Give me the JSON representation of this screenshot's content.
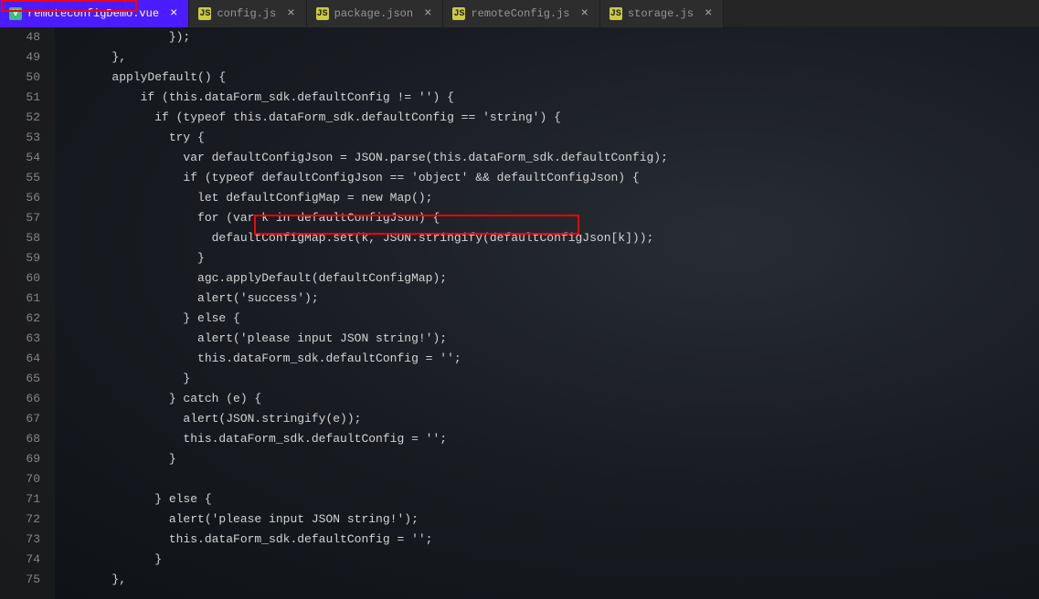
{
  "tabs": [
    {
      "icon": "V",
      "label": "remoteconfigDemo.vue",
      "active": true
    },
    {
      "icon": "JS",
      "label": "config.js",
      "active": false
    },
    {
      "icon": "JS",
      "label": "package.json",
      "active": false
    },
    {
      "icon": "JS",
      "label": "remoteConfig.js",
      "active": false
    },
    {
      "icon": "JS",
      "label": "storage.js",
      "active": false
    }
  ],
  "tab_close": "×",
  "line_numbers": [
    "48",
    "49",
    "50",
    "51",
    "52",
    "53",
    "54",
    "55",
    "56",
    "57",
    "58",
    "59",
    "60",
    "61",
    "62",
    "63",
    "64",
    "65",
    "66",
    "67",
    "68",
    "69",
    "70",
    "71",
    "72",
    "73",
    "74",
    "75"
  ],
  "code": {
    "l48": "                });",
    "l49": "        },",
    "l50": "        applyDefault() {",
    "l51": "            if (this.dataForm_sdk.defaultConfig != '') {",
    "l52": "              if (typeof this.dataForm_sdk.defaultConfig == 'string') {",
    "l53": "                try {",
    "l54": "                  var defaultConfigJson = JSON.parse(this.dataForm_sdk.defaultConfig);",
    "l55": "                  if (typeof defaultConfigJson == 'object' && defaultConfigJson) {",
    "l56": "                    let defaultConfigMap = new Map();",
    "l57": "                    for (var k in defaultConfigJson) {",
    "l58": "                      defaultConfigMap.set(k, JSON.stringify(defaultConfigJson[k]));",
    "l59": "                    }",
    "l60": "                    agc.applyDefault(defaultConfigMap);",
    "l61": "                    alert('success');",
    "l62": "                  } else {",
    "l63": "                    alert('please input JSON string!');",
    "l64": "                    this.dataForm_sdk.defaultConfig = '';",
    "l65": "                  }",
    "l66": "                } catch (e) {",
    "l67": "                  alert(JSON.stringify(e));",
    "l68": "                  this.dataForm_sdk.defaultConfig = '';",
    "l69": "                }",
    "l70": "",
    "l71": "              } else {",
    "l72": "                alert('please input JSON string!');",
    "l73": "                this.dataForm_sdk.defaultConfig = '';",
    "l74": "              }",
    "l75": "        },"
  }
}
